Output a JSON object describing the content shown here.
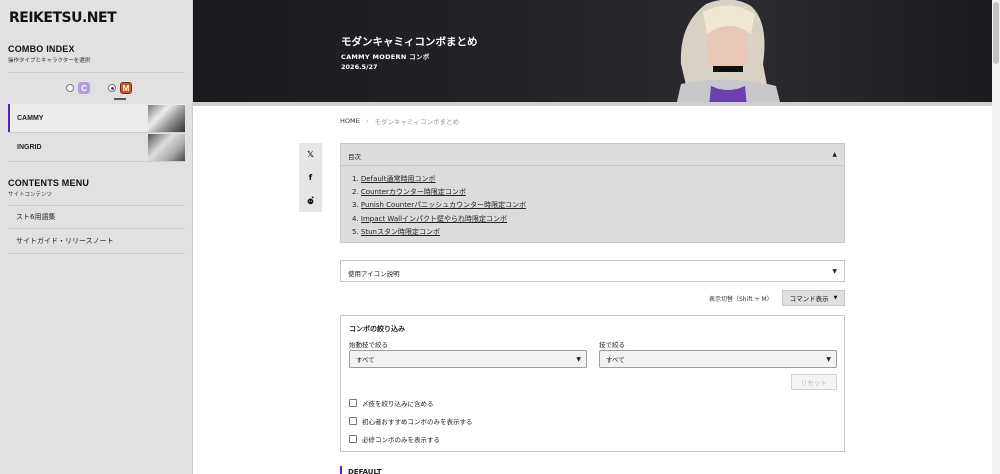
{
  "sidebar": {
    "logo": "REIKETSU.NET",
    "combo_index": {
      "title": "COMBO INDEX",
      "subtitle": "操作タイプとキャラクターを選択"
    },
    "modes": [
      {
        "name": "classic",
        "letter": "C",
        "selected": false
      },
      {
        "name": "modern",
        "letter": "M",
        "selected": true
      }
    ],
    "characters": [
      {
        "label": "CAMMY",
        "active": true
      },
      {
        "label": "INGRID",
        "active": false
      }
    ],
    "contents_menu": {
      "title": "CONTENTS MENU",
      "subtitle": "サイトコンテンツ"
    },
    "menu_items": [
      "スト6用語集",
      "サイトガイド・リリースノート"
    ]
  },
  "hero": {
    "title": "モダンキャミィコンボまとめ",
    "subtitle": "CAMMY MODERN コンボ",
    "date": "2026.5/27"
  },
  "breadcrumb": {
    "home": "HOME",
    "current": "モダンキャミィコンボまとめ"
  },
  "toc": {
    "title": "目次",
    "items": [
      {
        "num": "1.",
        "label": "Default通常時用コンボ"
      },
      {
        "num": "2.",
        "label": "Counterカウンター時限定コンボ"
      },
      {
        "num": "3.",
        "label": "Punish Counterパニッシュカウンター時限定コンボ"
      },
      {
        "num": "4.",
        "label": "Impact Wallインパクト壁やられ時限定コンボ"
      },
      {
        "num": "5.",
        "label": "Stunスタン時限定コンボ"
      }
    ]
  },
  "icon_legend": {
    "label": "使用アイコン説明"
  },
  "display_toggle": {
    "label": "表示切替（Shift + M）",
    "button": "コマンド表示"
  },
  "filter": {
    "title": "コンボの絞り込み",
    "starter_label": "始動技で絞る",
    "starter_value": "すべて",
    "move_label": "技で絞る",
    "move_value": "すべて",
    "reset": "リセット",
    "checkboxes": [
      "〆技を絞り込みに含める",
      "初心者おすすめコンボのみを表示する",
      "必修コンボのみを表示する"
    ]
  },
  "section_heading": "DEFAULT",
  "colors": {
    "accent": "#5a1ec7",
    "sidebar_bg": "#e1e1e1",
    "hero_bg": "#1f1f25"
  }
}
